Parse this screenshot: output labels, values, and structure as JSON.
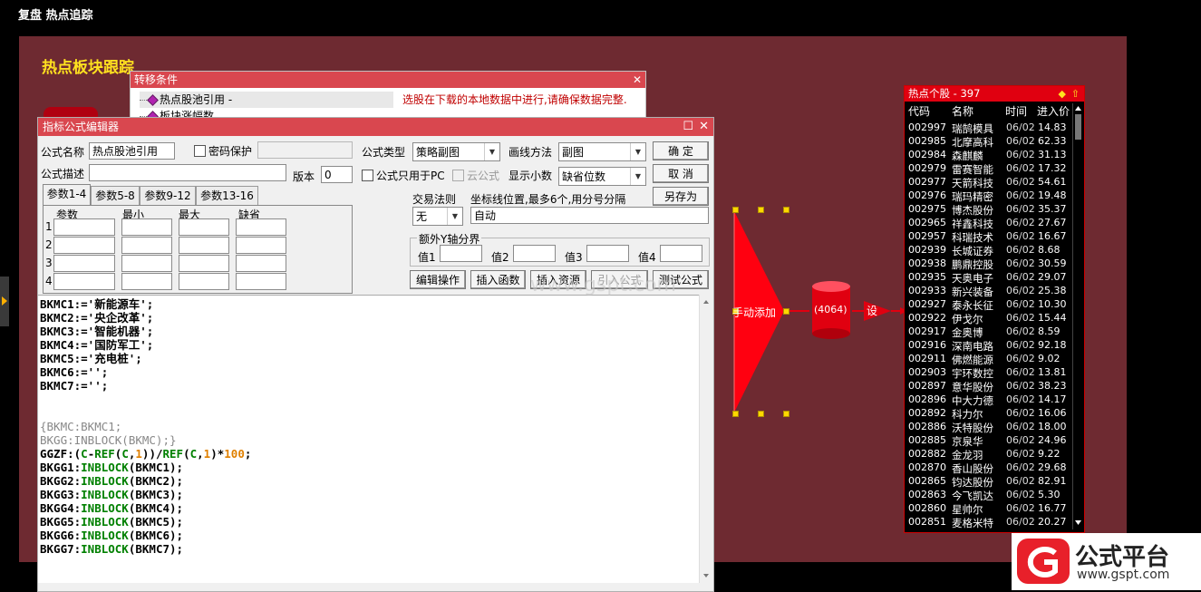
{
  "app": {
    "title": "复盘 热点追踪"
  },
  "canvas": {
    "title": "热点板块跟踪"
  },
  "transfer": {
    "title": "转移条件",
    "close": "✕",
    "items": [
      "热点股池引用 -",
      "板块涨幅数"
    ],
    "note": "选股在下载的本地数据中进行,请确保数据完整."
  },
  "editor": {
    "title": "指标公式编辑器",
    "name_label": "公式名称",
    "name_value": "热点股池引用",
    "password_label": "密码保护",
    "type_label": "公式类型",
    "type_value": "策略副图",
    "draw_label": "画线方法",
    "draw_value": "副图",
    "ok": "确  定",
    "cancel": "取  消",
    "save_as": "另存为",
    "desc_label": "公式描述",
    "version_label": "版本",
    "version_value": "0",
    "pc_only": "公式只用于PC",
    "cloud": "云公式",
    "decimals_label": "显示小数",
    "decimals_value": "缺省位数",
    "tabs": [
      "参数1-4",
      "参数5-8",
      "参数9-12",
      "参数13-16"
    ],
    "param_headers": [
      "参数",
      "最小",
      "最大",
      "缺省"
    ],
    "param_rows": [
      "1",
      "2",
      "3",
      "4"
    ],
    "trade_rule_label": "交易法则",
    "trade_rule_value": "无",
    "coord_label": "坐标线位置,最多6个,用分号分隔",
    "coord_value": "自动",
    "yaxis_label": "额外Y轴分界",
    "val_labels": [
      "值1",
      "值2",
      "值3",
      "值4"
    ],
    "buttons": [
      "编辑操作",
      "插入函数",
      "插入资源",
      "引入公式",
      "测试公式"
    ]
  },
  "code_lines": [
    "BKMC1:='新能源车';",
    "BKMC2:='央企改革';",
    "BKMC3:='智能机器';",
    "BKMC4:='国防军工';",
    "BKMC5:='充电桩';",
    "BKMC6:='';",
    "BKMC7:='';",
    "",
    "",
    "{BKMC:BKMC1;",
    "BKGG:INBLOCK(BKMC);}",
    "GGZF:(C-REF(C,1))/REF(C,1)*100;",
    "BKGG1:INBLOCK(BKMC1);",
    "BKGG2:INBLOCK(BKMC2);",
    "BKGG3:INBLOCK(BKMC3);",
    "BKGG4:INBLOCK(BKMC4);",
    "BKGG5:INBLOCK(BKMC5);",
    "BKGG6:INBLOCK(BKMC6);",
    "BKGG7:INBLOCK(BKMC7);"
  ],
  "flow": {
    "manual_add": "手动添加",
    "pool_count": "(4064)",
    "set": "设"
  },
  "hot": {
    "title": "热点个股 - 397",
    "headers": [
      "代码",
      "名称",
      "时间",
      "进入价"
    ],
    "rows": [
      [
        "002997",
        "瑞鹄模具",
        "06/02",
        "14.83"
      ],
      [
        "002985",
        "北摩高科",
        "06/02",
        "62.33"
      ],
      [
        "002984",
        "森麒麟",
        "06/02",
        "31.13"
      ],
      [
        "002979",
        "雷赛智能",
        "06/02",
        "17.32"
      ],
      [
        "002977",
        "天箭科技",
        "06/02",
        "54.61"
      ],
      [
        "002976",
        "瑞玛精密",
        "06/02",
        "19.48"
      ],
      [
        "002975",
        "博杰股份",
        "06/02",
        "35.37"
      ],
      [
        "002965",
        "祥鑫科技",
        "06/02",
        "27.67"
      ],
      [
        "002957",
        "科瑞技术",
        "06/02",
        "16.67"
      ],
      [
        "002939",
        "长城证券",
        "06/02",
        "8.68"
      ],
      [
        "002938",
        "鹏鼎控股",
        "06/02",
        "30.59"
      ],
      [
        "002935",
        "天奥电子",
        "06/02",
        "29.07"
      ],
      [
        "002933",
        "新兴装备",
        "06/02",
        "25.38"
      ],
      [
        "002927",
        "泰永长征",
        "06/02",
        "10.30"
      ],
      [
        "002922",
        "伊戈尔",
        "06/02",
        "15.44"
      ],
      [
        "002917",
        "金奥博",
        "06/02",
        "8.59"
      ],
      [
        "002916",
        "深南电路",
        "06/02",
        "92.18"
      ],
      [
        "002911",
        "佛燃能源",
        "06/02",
        "9.02"
      ],
      [
        "002903",
        "宇环数控",
        "06/02",
        "13.81"
      ],
      [
        "002897",
        "意华股份",
        "06/02",
        "38.23"
      ],
      [
        "002896",
        "中大力德",
        "06/02",
        "14.17"
      ],
      [
        "002892",
        "科力尔",
        "06/02",
        "16.06"
      ],
      [
        "002886",
        "沃特股份",
        "06/02",
        "18.00"
      ],
      [
        "002885",
        "京泉华",
        "06/02",
        "24.96"
      ],
      [
        "002882",
        "金龙羽",
        "06/02",
        "9.22"
      ],
      [
        "002870",
        "香山股份",
        "06/02",
        "29.68"
      ],
      [
        "002865",
        "钧达股份",
        "06/02",
        "82.91"
      ],
      [
        "002863",
        "今飞凯达",
        "06/02",
        "5.30"
      ],
      [
        "002860",
        "星帅尔",
        "06/02",
        "16.77"
      ],
      [
        "002851",
        "麦格米特",
        "06/02",
        "20.27"
      ]
    ]
  },
  "watermark": {
    "text": "www.gspt.com",
    "logo_name": "公式平台",
    "logo_url": "www.gspt.com"
  },
  "colors": {
    "canvas": "#6e2a31",
    "accent_red": "#e00010",
    "titlebar": "#d9474f"
  }
}
